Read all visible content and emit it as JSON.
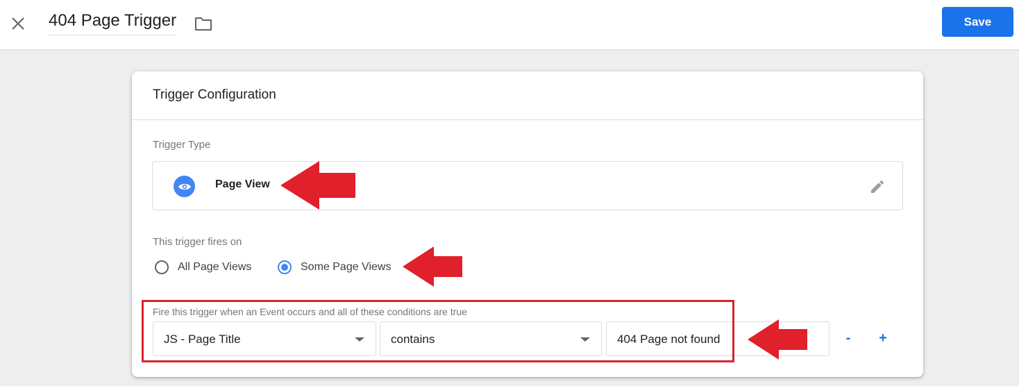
{
  "header": {
    "title": "404 Page Trigger",
    "save_label": "Save",
    "close_icon": "close-icon",
    "folder_icon": "folder-icon"
  },
  "card": {
    "title": "Trigger Configuration",
    "trigger_type_label": "Trigger Type",
    "trigger_type": {
      "name": "Page View",
      "icon": "eye-icon",
      "edit_icon": "pencil-icon"
    },
    "fires_on_label": "This trigger fires on",
    "fires_on_options": [
      {
        "label": "All Page Views",
        "selected": false
      },
      {
        "label": "Some Page Views",
        "selected": true
      }
    ],
    "condition_label": "Fire this trigger when an Event occurs and all of these conditions are true",
    "condition": {
      "variable": "JS - Page Title",
      "operator": "contains",
      "value": "404 Page not found"
    },
    "remove_label": "-",
    "add_label": "+"
  },
  "colors": {
    "accent": "#1a73e8",
    "eye_icon_bg": "#4285f4",
    "annotation_red": "#d7232f"
  }
}
